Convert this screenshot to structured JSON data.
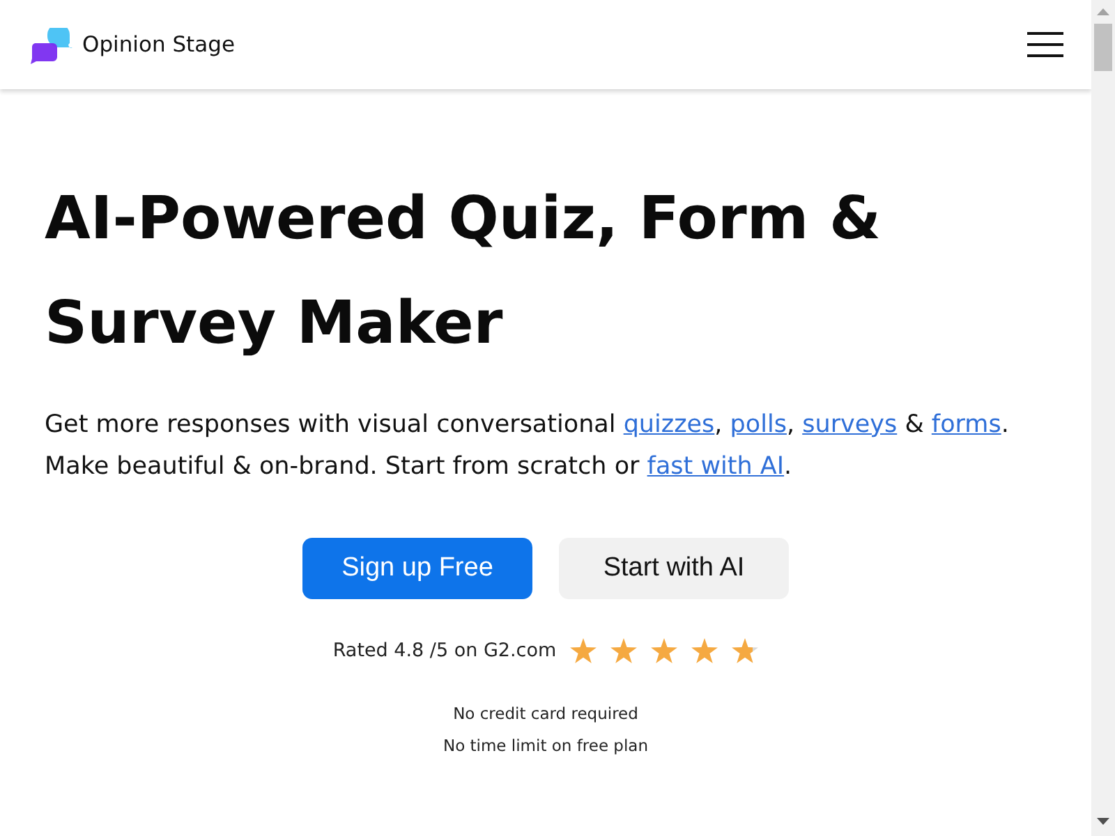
{
  "header": {
    "brand": "Opinion Stage"
  },
  "hero": {
    "title": "AI-Powered Quiz, Form & Survey Maker",
    "intro": [
      {
        "kind": "text",
        "text": "Get more responses with visual conversational "
      },
      {
        "kind": "link",
        "text": "quizzes"
      },
      {
        "kind": "text",
        "text": ", "
      },
      {
        "kind": "link",
        "text": "polls"
      },
      {
        "kind": "text",
        "text": ", "
      },
      {
        "kind": "link",
        "text": "surveys"
      },
      {
        "kind": "text",
        "text": " & "
      },
      {
        "kind": "link",
        "text": "forms"
      },
      {
        "kind": "text",
        "text": ". Make beautiful & on-brand. Start from scratch or "
      },
      {
        "kind": "link",
        "text": "fast with AI"
      },
      {
        "kind": "text",
        "text": "."
      }
    ],
    "actions": [
      {
        "kind": "primary",
        "label": "Sign up Free"
      },
      {
        "kind": "secondary",
        "label": "Start with AI"
      }
    ],
    "rating": {
      "text": "Rated 4.8 /5 on G2.com",
      "stars": 4.8
    },
    "notes": [
      "No credit card required",
      "No time limit on free plan"
    ]
  }
}
